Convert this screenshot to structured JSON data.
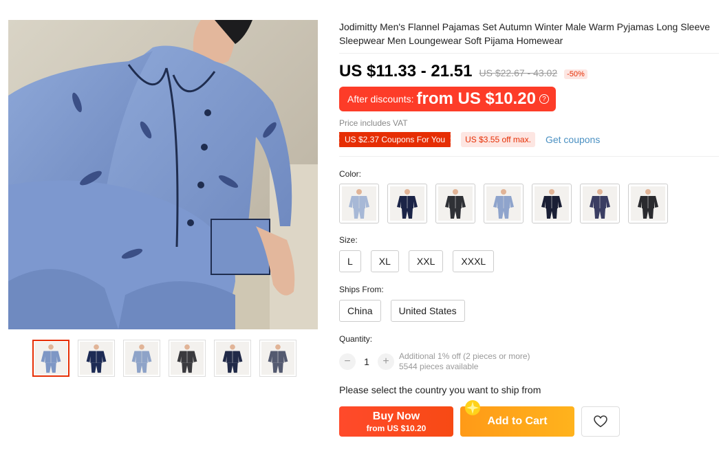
{
  "product": {
    "title": "Jodimitty Men's Flannel Pajamas Set Autumn Winter Male Warm Pyjamas Long Sleeve Sleepwear Men Loungewear Soft Pijama Homewear",
    "price": "US $11.33 - 21.51",
    "original_price": "US $22.67 - 43.02",
    "discount_percent": "-50%",
    "after_discounts_label": "After discounts:",
    "after_discounts_amount": "from US $10.20",
    "vat_note": "Price includes VAT",
    "coupon_tag": "US $2.37 Coupons For You",
    "coupon_off": "US $3.55 off max.",
    "get_coupons": "Get coupons"
  },
  "gallery": {
    "main_image_icon": "pajamas-photo",
    "thumbnails": [
      {
        "icon": "light-blue-pajamas-thumb",
        "color": "#7e97c5",
        "selected": true
      },
      {
        "icon": "navy-pajamas-thumb",
        "color": "#1d2b55",
        "selected": false
      },
      {
        "icon": "blue-grey-pajamas-thumb",
        "color": "#8ea3c8",
        "selected": false
      },
      {
        "icon": "dark-grey-pajamas-thumb",
        "color": "#3a3a3e",
        "selected": false
      },
      {
        "icon": "navy-red-pajamas-thumb",
        "color": "#212a48",
        "selected": false
      },
      {
        "icon": "grey-pajamas-thumb",
        "color": "#545a70",
        "selected": false
      }
    ]
  },
  "color": {
    "label": "Color:",
    "swatches": [
      {
        "icon": "light-blue-pajama-swatch",
        "color": "#a7b8d6"
      },
      {
        "icon": "navy-pajama-swatch",
        "color": "#1b2447"
      },
      {
        "icon": "charcoal-pajama-swatch",
        "color": "#2f3136"
      },
      {
        "icon": "blue-photo-pajama-swatch",
        "color": "#8fa4cc"
      },
      {
        "icon": "dark-navy-pajama-swatch",
        "color": "#1a1f35"
      },
      {
        "icon": "purple-navy-pajama-swatch",
        "color": "#3a3d62"
      },
      {
        "icon": "black-pajama-swatch",
        "color": "#2a2a2e"
      }
    ]
  },
  "size": {
    "label": "Size:",
    "options": [
      "L",
      "XL",
      "XXL",
      "XXXL"
    ]
  },
  "ships_from": {
    "label": "Ships From:",
    "options": [
      "China",
      "United States"
    ]
  },
  "quantity": {
    "label": "Quantity:",
    "value": "1",
    "minus": "−",
    "plus": "+",
    "extra_discount": "Additional 1% off (2 pieces or more)",
    "available": "5544 pieces available"
  },
  "ship_message": "Please select the country you want to ship from",
  "actions": {
    "buy_now": "Buy Now",
    "buy_now_sub": "from US $10.20",
    "add_to_cart": "Add to Cart",
    "wishlist_icon": "heart-icon"
  },
  "colors": {
    "accent_red": "#e62e04",
    "buy_now_bg": "#f74a14",
    "cart_bg": "#ffa21b",
    "link_blue": "#4a90c2"
  }
}
